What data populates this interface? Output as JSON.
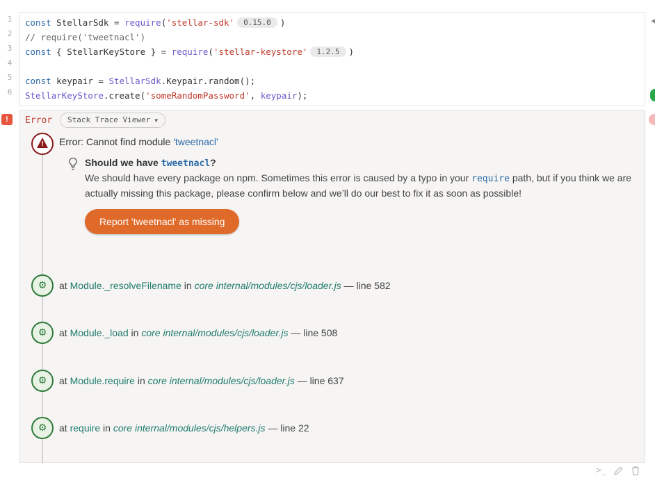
{
  "code": {
    "line_numbers": [
      "1",
      "2",
      "3",
      "4",
      "5",
      "6"
    ],
    "l1": {
      "kw": "const",
      "var": " StellarSdk = ",
      "fn": "require",
      "open": "(",
      "str": "'stellar-sdk'",
      "ver": "0.15.0",
      "close": ")"
    },
    "l2": {
      "comment": "// require('tweetnacl')"
    },
    "l3": {
      "kw": "const",
      "var": " { StellarKeyStore } = ",
      "fn": "require",
      "open": "(",
      "str": "'stellar-keystore'",
      "ver": "1.2.5",
      "close": ")"
    },
    "l5": {
      "kw": "const",
      "var": " keypair = ",
      "obj": "StellarSdk",
      "rest": ".Keypair.random();"
    },
    "l6": {
      "obj": "StellarKeyStore",
      "mid": ".create(",
      "str": "'someRandomPassword'",
      "sep": ", ",
      "arg": "keypair",
      "end": ");"
    }
  },
  "error_badge": "!",
  "error_label": "Error",
  "viewer_button": "Stack Trace Viewer",
  "error_title": {
    "prefix": "Error: Cannot find module ",
    "module": "'tweetnacl'"
  },
  "suggestion": {
    "q_prefix": "Should we have ",
    "q_pkg": "tweetnacl",
    "q_suffix": "?",
    "body_1": "We should have every package on npm. Sometimes this error is caused by a typo in your ",
    "body_code": "require",
    "body_2": " path, but if you think we are actually missing this package, please confirm below and we’ll do our best to fix it as soon as possible!",
    "button": "Report 'tweetnacl' as missing"
  },
  "stack": [
    {
      "at": "at ",
      "fn": "Module._resolveFilename",
      "in": " in ",
      "path": "core internal/modules/cjs/loader.js",
      "line": " — line 582"
    },
    {
      "at": "at ",
      "fn": "Module._load",
      "in": " in ",
      "path": "core internal/modules/cjs/loader.js",
      "line": " — line 508"
    },
    {
      "at": "at ",
      "fn": "Module.require",
      "in": " in ",
      "path": "core internal/modules/cjs/loader.js",
      "line": " — line 637"
    },
    {
      "at": "at ",
      "fn": "require",
      "in": " in ",
      "path": "core internal/modules/cjs/helpers.js",
      "line": " — line 22"
    }
  ],
  "icons": [
    "warning-icon",
    "lightbulb-icon",
    "gears-icon",
    "terminal-icon",
    "pencil-icon",
    "trash-icon"
  ],
  "colors": {
    "error": "#c0392b",
    "button": "#e06a2a",
    "frame_green": "#2f7a3a",
    "link": "#2c6aa8"
  }
}
